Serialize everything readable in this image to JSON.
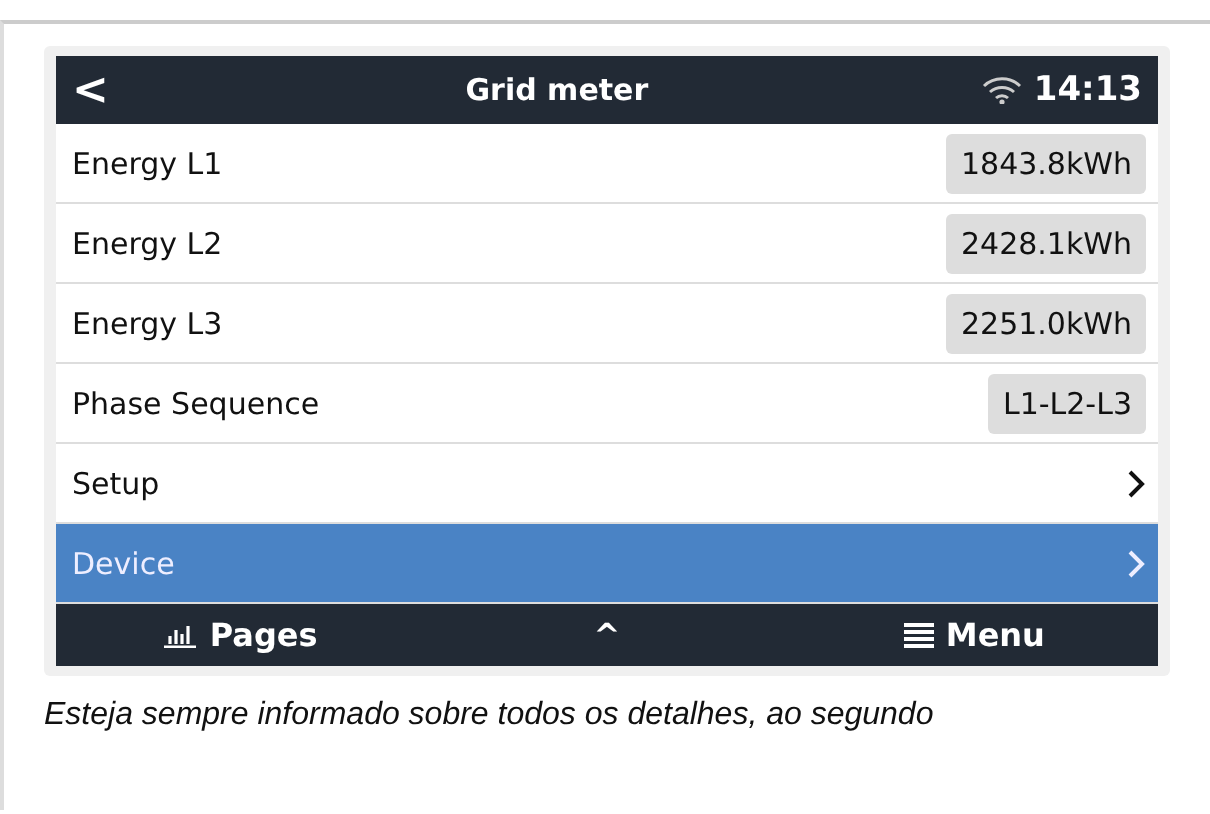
{
  "header": {
    "back": "<",
    "title": "Grid meter",
    "time": "14:13"
  },
  "rows": [
    {
      "kind": "value",
      "label": "Energy L1",
      "value": "1843.8kWh",
      "selected": false
    },
    {
      "kind": "value",
      "label": "Energy L2",
      "value": "2428.1kWh",
      "selected": false
    },
    {
      "kind": "value",
      "label": "Energy L3",
      "value": "2251.0kWh",
      "selected": false
    },
    {
      "kind": "value",
      "label": "Phase Sequence",
      "value": "L1-L2-L3",
      "selected": false
    },
    {
      "kind": "link",
      "label": "Setup",
      "selected": false
    },
    {
      "kind": "link",
      "label": "Device",
      "selected": true
    }
  ],
  "footer": {
    "pages": "Pages",
    "up": "^",
    "menu": "Menu"
  },
  "caption": "Esteja sempre informado sobre todos os detalhes, ao segundo"
}
